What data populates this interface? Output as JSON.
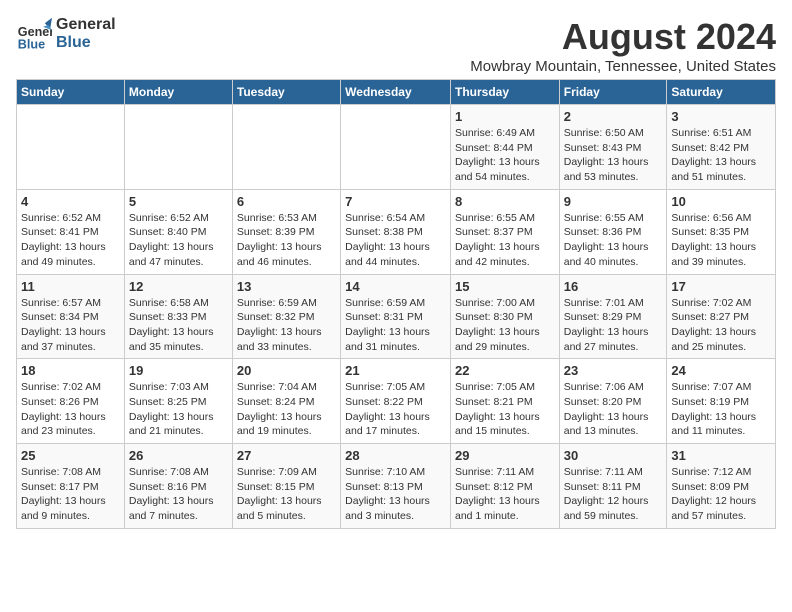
{
  "logo": {
    "line1": "General",
    "line2": "Blue"
  },
  "title": "August 2024",
  "subtitle": "Mowbray Mountain, Tennessee, United States",
  "days_of_week": [
    "Sunday",
    "Monday",
    "Tuesday",
    "Wednesday",
    "Thursday",
    "Friday",
    "Saturday"
  ],
  "weeks": [
    [
      {
        "day": "",
        "info": ""
      },
      {
        "day": "",
        "info": ""
      },
      {
        "day": "",
        "info": ""
      },
      {
        "day": "",
        "info": ""
      },
      {
        "day": "1",
        "info": "Sunrise: 6:49 AM\nSunset: 8:44 PM\nDaylight: 13 hours\nand 54 minutes."
      },
      {
        "day": "2",
        "info": "Sunrise: 6:50 AM\nSunset: 8:43 PM\nDaylight: 13 hours\nand 53 minutes."
      },
      {
        "day": "3",
        "info": "Sunrise: 6:51 AM\nSunset: 8:42 PM\nDaylight: 13 hours\nand 51 minutes."
      }
    ],
    [
      {
        "day": "4",
        "info": "Sunrise: 6:52 AM\nSunset: 8:41 PM\nDaylight: 13 hours\nand 49 minutes."
      },
      {
        "day": "5",
        "info": "Sunrise: 6:52 AM\nSunset: 8:40 PM\nDaylight: 13 hours\nand 47 minutes."
      },
      {
        "day": "6",
        "info": "Sunrise: 6:53 AM\nSunset: 8:39 PM\nDaylight: 13 hours\nand 46 minutes."
      },
      {
        "day": "7",
        "info": "Sunrise: 6:54 AM\nSunset: 8:38 PM\nDaylight: 13 hours\nand 44 minutes."
      },
      {
        "day": "8",
        "info": "Sunrise: 6:55 AM\nSunset: 8:37 PM\nDaylight: 13 hours\nand 42 minutes."
      },
      {
        "day": "9",
        "info": "Sunrise: 6:55 AM\nSunset: 8:36 PM\nDaylight: 13 hours\nand 40 minutes."
      },
      {
        "day": "10",
        "info": "Sunrise: 6:56 AM\nSunset: 8:35 PM\nDaylight: 13 hours\nand 39 minutes."
      }
    ],
    [
      {
        "day": "11",
        "info": "Sunrise: 6:57 AM\nSunset: 8:34 PM\nDaylight: 13 hours\nand 37 minutes."
      },
      {
        "day": "12",
        "info": "Sunrise: 6:58 AM\nSunset: 8:33 PM\nDaylight: 13 hours\nand 35 minutes."
      },
      {
        "day": "13",
        "info": "Sunrise: 6:59 AM\nSunset: 8:32 PM\nDaylight: 13 hours\nand 33 minutes."
      },
      {
        "day": "14",
        "info": "Sunrise: 6:59 AM\nSunset: 8:31 PM\nDaylight: 13 hours\nand 31 minutes."
      },
      {
        "day": "15",
        "info": "Sunrise: 7:00 AM\nSunset: 8:30 PM\nDaylight: 13 hours\nand 29 minutes."
      },
      {
        "day": "16",
        "info": "Sunrise: 7:01 AM\nSunset: 8:29 PM\nDaylight: 13 hours\nand 27 minutes."
      },
      {
        "day": "17",
        "info": "Sunrise: 7:02 AM\nSunset: 8:27 PM\nDaylight: 13 hours\nand 25 minutes."
      }
    ],
    [
      {
        "day": "18",
        "info": "Sunrise: 7:02 AM\nSunset: 8:26 PM\nDaylight: 13 hours\nand 23 minutes."
      },
      {
        "day": "19",
        "info": "Sunrise: 7:03 AM\nSunset: 8:25 PM\nDaylight: 13 hours\nand 21 minutes."
      },
      {
        "day": "20",
        "info": "Sunrise: 7:04 AM\nSunset: 8:24 PM\nDaylight: 13 hours\nand 19 minutes."
      },
      {
        "day": "21",
        "info": "Sunrise: 7:05 AM\nSunset: 8:22 PM\nDaylight: 13 hours\nand 17 minutes."
      },
      {
        "day": "22",
        "info": "Sunrise: 7:05 AM\nSunset: 8:21 PM\nDaylight: 13 hours\nand 15 minutes."
      },
      {
        "day": "23",
        "info": "Sunrise: 7:06 AM\nSunset: 8:20 PM\nDaylight: 13 hours\nand 13 minutes."
      },
      {
        "day": "24",
        "info": "Sunrise: 7:07 AM\nSunset: 8:19 PM\nDaylight: 13 hours\nand 11 minutes."
      }
    ],
    [
      {
        "day": "25",
        "info": "Sunrise: 7:08 AM\nSunset: 8:17 PM\nDaylight: 13 hours\nand 9 minutes."
      },
      {
        "day": "26",
        "info": "Sunrise: 7:08 AM\nSunset: 8:16 PM\nDaylight: 13 hours\nand 7 minutes."
      },
      {
        "day": "27",
        "info": "Sunrise: 7:09 AM\nSunset: 8:15 PM\nDaylight: 13 hours\nand 5 minutes."
      },
      {
        "day": "28",
        "info": "Sunrise: 7:10 AM\nSunset: 8:13 PM\nDaylight: 13 hours\nand 3 minutes."
      },
      {
        "day": "29",
        "info": "Sunrise: 7:11 AM\nSunset: 8:12 PM\nDaylight: 13 hours\nand 1 minute."
      },
      {
        "day": "30",
        "info": "Sunrise: 7:11 AM\nSunset: 8:11 PM\nDaylight: 12 hours\nand 59 minutes."
      },
      {
        "day": "31",
        "info": "Sunrise: 7:12 AM\nSunset: 8:09 PM\nDaylight: 12 hours\nand 57 minutes."
      }
    ]
  ]
}
